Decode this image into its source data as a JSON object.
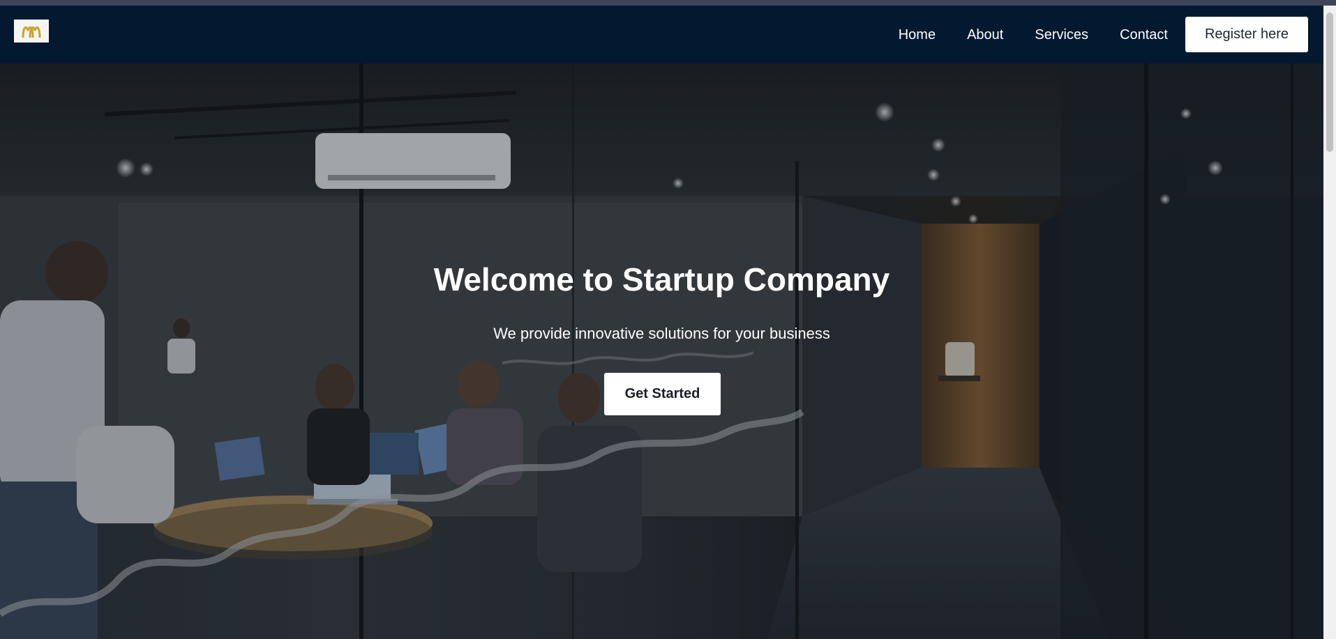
{
  "nav": {
    "links": [
      "Home",
      "About",
      "Services",
      "Contact"
    ],
    "register_label": "Register here"
  },
  "hero": {
    "title": "Welcome to Startup Company",
    "subtitle": "We provide innovative solutions for your business",
    "cta_label": "Get Started"
  },
  "colors": {
    "navbar": "#021930",
    "logo_mark": "#c9a227",
    "button_bg": "#ffffff",
    "hero_text": "#ffffff"
  },
  "icons": {
    "logo": "arches-logo-icon"
  }
}
